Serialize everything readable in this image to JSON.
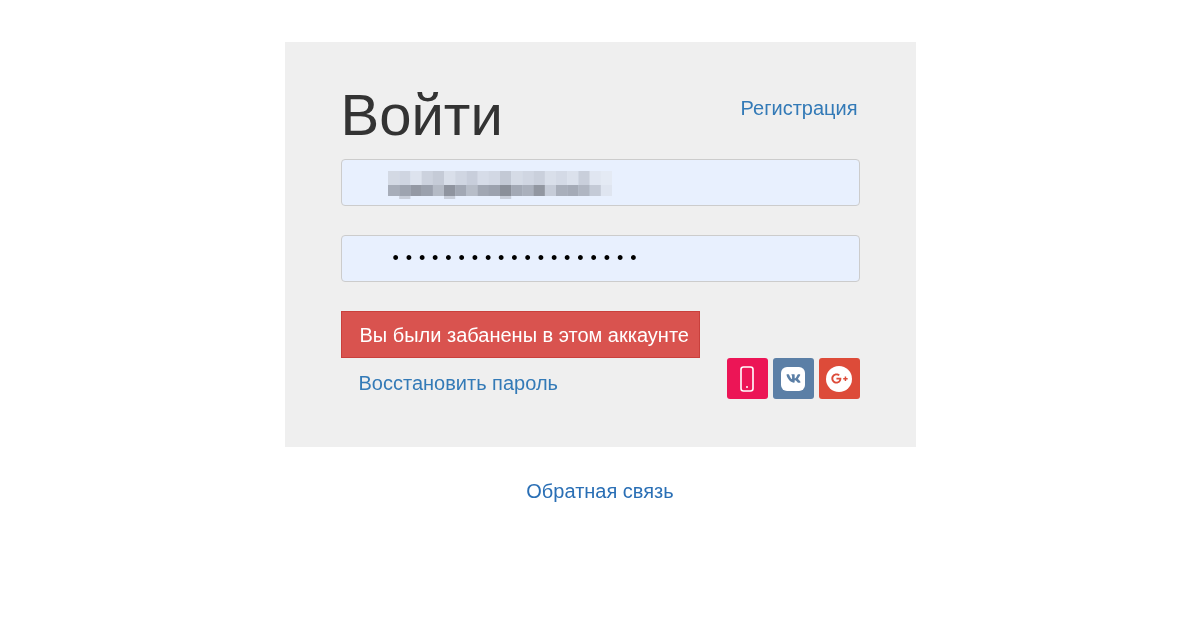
{
  "login_form": {
    "title": "Войти",
    "register_link": "Регистрация",
    "password_field": {
      "value": "•••••••••••••••••••"
    },
    "error_message": "Вы были забанены в этом аккаунте",
    "recover_password_link": "Восстановить пароль",
    "social_logins": [
      {
        "kind": "phone",
        "color": "#ec1556"
      },
      {
        "kind": "vk",
        "color": "#5b7fa6"
      },
      {
        "kind": "google-plus",
        "color": "#dd4b39"
      }
    ]
  },
  "feedback_link": "Обратная связь"
}
